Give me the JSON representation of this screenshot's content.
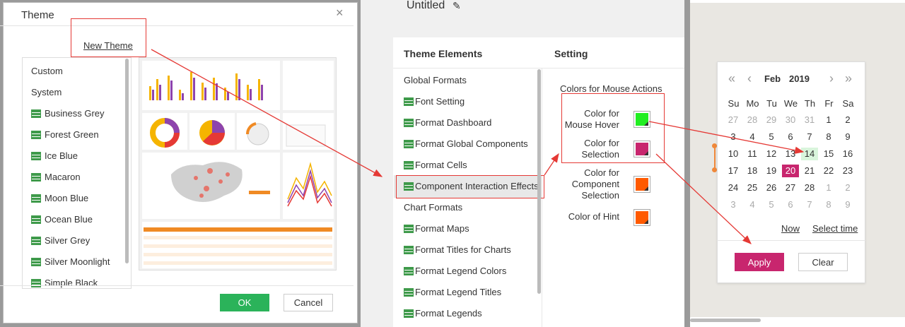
{
  "theme_dialog": {
    "title": "Theme",
    "close_glyph": "×",
    "new_theme": "New Theme",
    "themes": [
      "Custom",
      "System",
      "Business Grey",
      "Forest Green",
      "Ice Blue",
      "Macaron",
      "Moon Blue",
      "Ocean Blue",
      "Silver Grey",
      "Silver Moonlight",
      "Simple Black"
    ],
    "ok_label": "OK",
    "cancel_label": "Cancel",
    "preview_icon": "dashboard-thumbnail"
  },
  "editor": {
    "title": "Untitled",
    "pencil_glyph": "✎",
    "elements_header": "Theme Elements",
    "setting_header": "Setting",
    "elements": [
      "Global Formats",
      "Font Setting",
      "Format Dashboard",
      "Format Global Components",
      "Format Cells",
      "Component Interaction Effects",
      "Chart Formats",
      "Format Maps",
      "Format Titles for Charts",
      "Format Legend Colors",
      "Format Legend Titles",
      "Format Legends"
    ],
    "elements_with_icon": [
      false,
      true,
      true,
      true,
      true,
      true,
      false,
      true,
      true,
      true,
      true,
      true
    ],
    "selected_element": "Component Interaction Effects",
    "settings_title": "Colors for Mouse Actions",
    "colors": [
      {
        "label_lines": [
          "Color for",
          "Mouse Hover"
        ],
        "color": "#22ee22"
      },
      {
        "label_lines": [
          "Color for",
          "Selection"
        ],
        "color": "#c8266e"
      },
      {
        "label_lines": [
          "Color for",
          "Component",
          "Selection"
        ],
        "color": "#ff5a00"
      },
      {
        "label_lines": [
          "Color of Hint"
        ],
        "color": "#ff5a00"
      }
    ]
  },
  "calendar": {
    "nav_prev_year": "«",
    "nav_prev_month": "‹",
    "nav_next_month": "›",
    "nav_next_year": "»",
    "month": "Feb",
    "year": "2019",
    "weekdays": [
      "Su",
      "Mo",
      "Tu",
      "We",
      "Th",
      "Fr",
      "Sa"
    ],
    "weeks": [
      [
        {
          "d": "27",
          "m": true
        },
        {
          "d": "28",
          "m": true
        },
        {
          "d": "29",
          "m": true
        },
        {
          "d": "30",
          "m": true
        },
        {
          "d": "31",
          "m": true
        },
        {
          "d": "1"
        },
        {
          "d": "2"
        }
      ],
      [
        {
          "d": "3"
        },
        {
          "d": "4"
        },
        {
          "d": "5"
        },
        {
          "d": "6"
        },
        {
          "d": "7"
        },
        {
          "d": "8"
        },
        {
          "d": "9"
        }
      ],
      [
        {
          "d": "10"
        },
        {
          "d": "11"
        },
        {
          "d": "12"
        },
        {
          "d": "13"
        },
        {
          "d": "14",
          "hl": true
        },
        {
          "d": "15"
        },
        {
          "d": "16"
        }
      ],
      [
        {
          "d": "17"
        },
        {
          "d": "18"
        },
        {
          "d": "19"
        },
        {
          "d": "20",
          "sel": true
        },
        {
          "d": "21"
        },
        {
          "d": "22"
        },
        {
          "d": "23"
        }
      ],
      [
        {
          "d": "24"
        },
        {
          "d": "25"
        },
        {
          "d": "26"
        },
        {
          "d": "27"
        },
        {
          "d": "28"
        },
        {
          "d": "1",
          "m": true
        },
        {
          "d": "2",
          "m": true
        }
      ],
      [
        {
          "d": "3",
          "m": true
        },
        {
          "d": "4",
          "m": true
        },
        {
          "d": "5",
          "m": true
        },
        {
          "d": "6",
          "m": true
        },
        {
          "d": "7",
          "m": true
        },
        {
          "d": "8",
          "m": true
        },
        {
          "d": "9",
          "m": true
        }
      ]
    ],
    "now_label": "Now",
    "select_time_label": "Select time",
    "apply_label": "Apply",
    "clear_label": "Clear"
  },
  "colors": {
    "ok_green": "#2bb35a",
    "accent": "#c8266e",
    "annotation_red": "#e53935",
    "hover_green": "#22ee22",
    "hint_orange": "#ff5a00"
  }
}
